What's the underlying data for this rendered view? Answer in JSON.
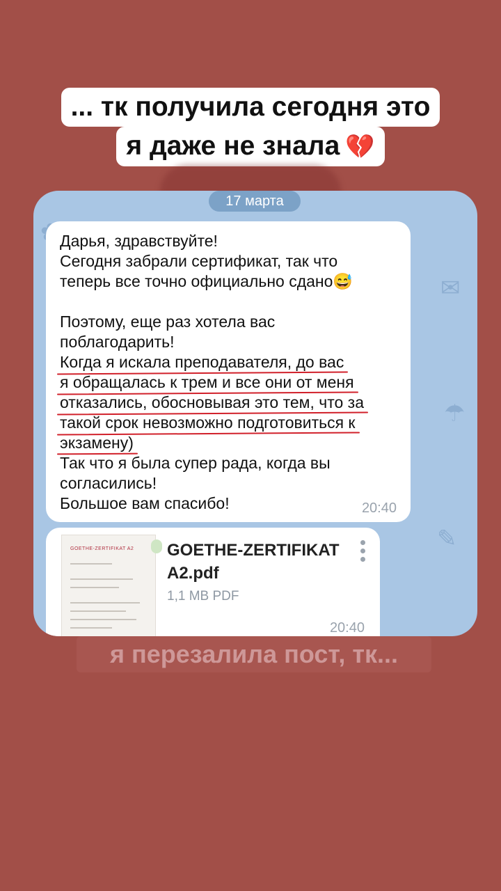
{
  "caption": {
    "line1": "... тк получила сегодня это",
    "line2": "я даже не знала",
    "heart_icon": "broken-heart"
  },
  "chat": {
    "date_label": "17 марта",
    "message": {
      "greeting": "Дарья, здравствуйте!",
      "line2": "Сегодня забрали сертификат, так что",
      "line3": "теперь все точно официально сдано😅",
      "line4": "Поэтому, еще раз хотела вас",
      "line5": "поблагодарить!",
      "hl1": "Когда я искала преподавателя, до вас",
      "hl2": "я обращалась к трем и все они от меня",
      "hl3": "отказались, обосновывая это тем, что за",
      "hl4": "такой срок невозможно подготовиться к",
      "hl5": "экзамену)",
      "line6": "Так что я была супер рада, когда вы",
      "line7": "согласились!",
      "line8": "Большое вам спасибо!",
      "time": "20:40"
    },
    "file": {
      "thumb_title": "GOETHE-ZERTIFIKAT A2",
      "name": "GOETHE-ZERTIFIKAT A2.pdf",
      "meta": "1,1 MB PDF",
      "time": "20:40"
    }
  },
  "bottom_caption": "я перезалила пост, тк...",
  "colors": {
    "background": "#a24f48",
    "chat_bg": "#a9c6e4",
    "underline": "#d1202a"
  }
}
